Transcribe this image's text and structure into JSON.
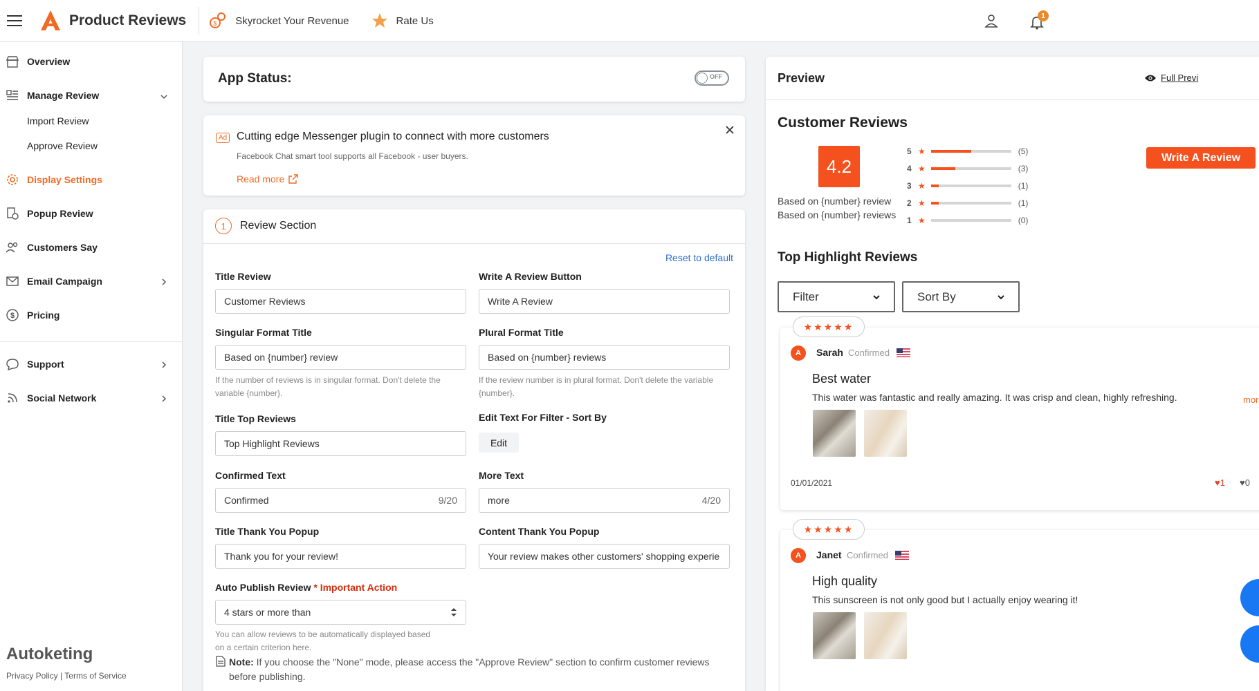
{
  "header": {
    "app_title": "Product Reviews",
    "link_revenue": "Skyrocket Your Revenue",
    "link_rate": "Rate Us",
    "notif_count": "1"
  },
  "sidebar": {
    "overview": "Overview",
    "manage_review": "Manage Review",
    "import_review": "Import Review",
    "approve_review": "Approve Review",
    "display_settings": "Display Settings",
    "popup_review": "Popup Review",
    "customers_say": "Customers Say",
    "email_campaign": "Email Campaign",
    "pricing": "Pricing",
    "support": "Support",
    "social_network": "Social Network",
    "footer_brand": "Autoketing",
    "privacy": "Privacy Policy",
    "sep": "|",
    "terms": "Terms of Service"
  },
  "status": {
    "label": "App Status:",
    "toggle": "OFF"
  },
  "ad": {
    "badge": "Ad",
    "title": "Cutting edge Messenger plugin to connect with more customers",
    "subtitle": "Facebook Chat smart tool supports all Facebook - user buyers.",
    "read_more": "Read more"
  },
  "section": {
    "step": "1",
    "title": "Review Section",
    "reset": "Reset to default",
    "title_review_label": "Title Review",
    "title_review_value": "Customer Reviews",
    "write_btn_label": "Write A Review Button",
    "write_btn_value": "Write A Review",
    "singular_label": "Singular Format Title",
    "singular_value": "Based on {number} review",
    "singular_help": "If the number of reviews is in singular format. Don't delete the variable {number}.",
    "plural_label": "Plural Format Title",
    "plural_value": "Based on {number} reviews",
    "plural_help": "If the review number is in plural format. Don't delete the variable {number}.",
    "top_label": "Title Top Reviews",
    "top_value": "Top Highlight Reviews",
    "filter_label": "Edit Text For Filter - Sort By",
    "edit_btn": "Edit",
    "confirmed_label": "Confirmed Text",
    "confirmed_value": "Confirmed",
    "confirmed_count": "9/20",
    "more_label": "More Text",
    "more_value": "more",
    "more_count": "4/20",
    "thank_label": "Title Thank You Popup",
    "thank_value": "Thank you for your review!",
    "content_label": "Content Thank You Popup",
    "content_value": "Your review makes other customers' shopping experie",
    "auto_label": "Auto Publish Review",
    "auto_required": "*",
    "auto_important": "Important Action",
    "auto_value": "4 stars or more than",
    "auto_help": "You can allow reviews to be automatically displayed based on a certain criterion here.",
    "note_label": "Note:",
    "note_text": "If you choose the \"None\" mode, please access the \"Approve Review\" section to confirm customer reviews before publishing."
  },
  "preview": {
    "title": "Preview",
    "full_preview": "Full Previ",
    "cr_title": "Customer Reviews",
    "score": "4.2",
    "based_review": "Based on {number} review",
    "based_reviews": "Based on {number} reviews",
    "write_button": "Write A Review",
    "ratings": [
      {
        "star": "5",
        "count": "(5)",
        "pct": 0.5
      },
      {
        "star": "4",
        "count": "(3)",
        "pct": 0.3
      },
      {
        "star": "3",
        "count": "(1)",
        "pct": 0.1
      },
      {
        "star": "2",
        "count": "(1)",
        "pct": 0.1
      },
      {
        "star": "1",
        "count": "(0)",
        "pct": 0
      }
    ],
    "top_title": "Top Highlight Reviews",
    "filter": "Filter",
    "sort": "Sort By",
    "reviews": [
      {
        "stars": "★★★★★",
        "avatar": "A",
        "name": "Sarah",
        "confirmed": "Confirmed",
        "title": "Best water",
        "body": "This water was fantastic and really amazing. It was crisp and clean, highly refreshing.",
        "more": "more",
        "date": "01/01/2021",
        "likes": "1",
        "dislikes": "0"
      },
      {
        "stars": "★★★★★",
        "avatar": "A",
        "name": "Janet",
        "confirmed": "Confirmed",
        "title": "High quality",
        "body": "This sunscreen is not only good but I actually enjoy wearing it!"
      }
    ]
  },
  "colors": {
    "accent": "#f06a24",
    "rating_orange": "#f4511e",
    "badge_red": "#e7401a"
  }
}
